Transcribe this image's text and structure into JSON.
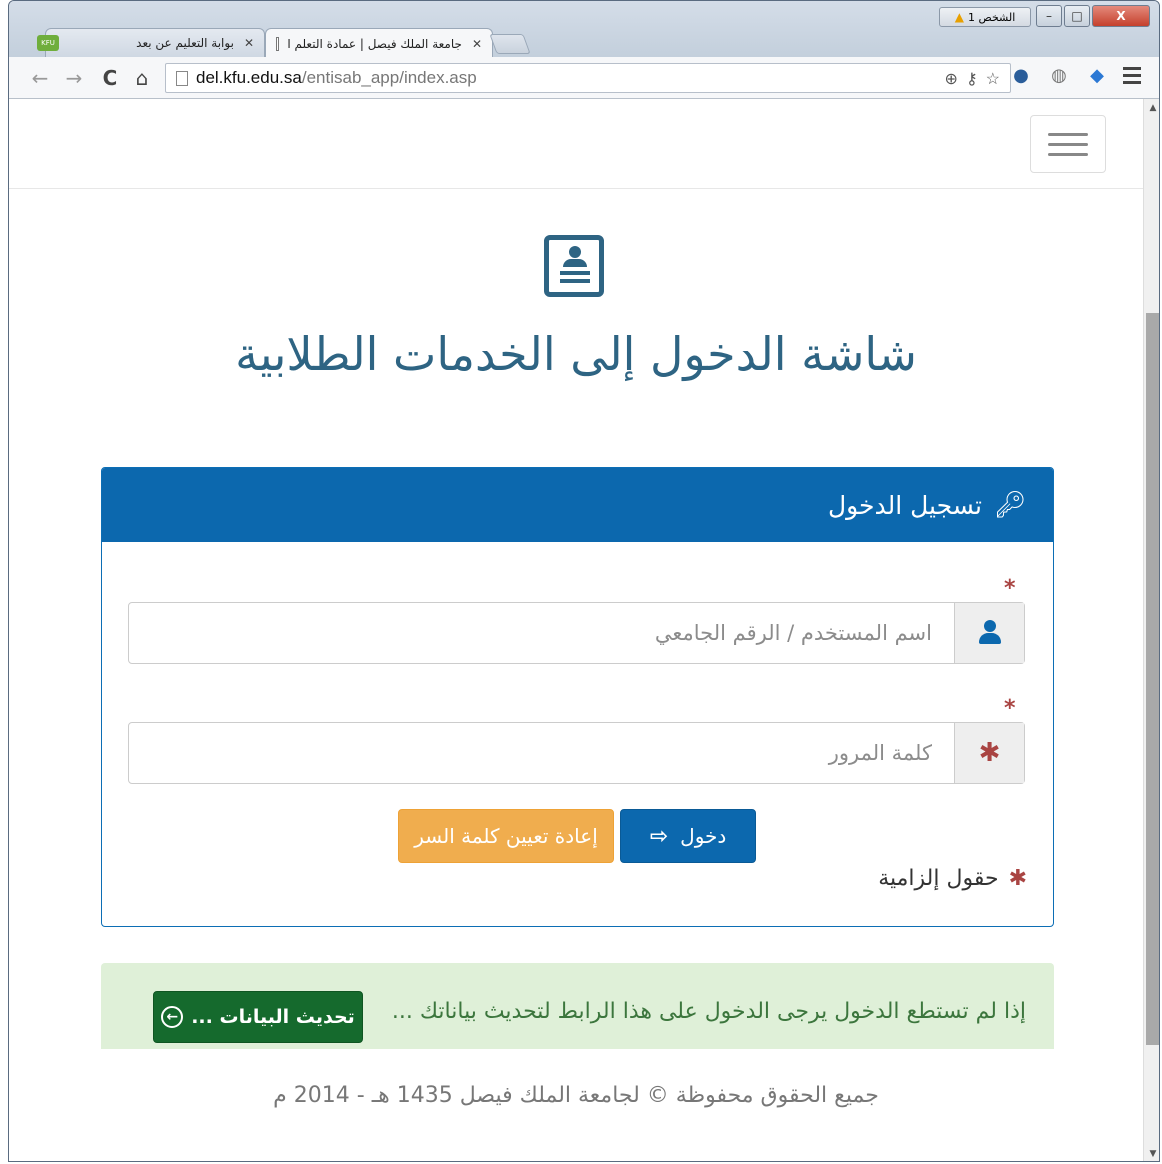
{
  "browser": {
    "tabs": [
      {
        "label": "جامعة الملك فيصل | عمادة التعلم ا",
        "active": true
      },
      {
        "label": "بوابة التعليم عن بعد",
        "active": false
      }
    ],
    "favicon_text": "KFU",
    "profile_label": "الشخص 1",
    "url_host": "del.kfu.edu.sa",
    "url_path": "/entisab_app/index.asp",
    "window_controls": {
      "minimize": "–",
      "maximize": "□",
      "close": "X"
    }
  },
  "page": {
    "title": "شاشة الدخول إلى الخدمات الطلابية",
    "login_panel": {
      "heading": "تسجيل الدخول",
      "username_placeholder": "اسم المستخدم / الرقم الجامعي",
      "username_value": "",
      "password_placeholder": "كلمة المرور",
      "password_value": "",
      "login_button": "دخول",
      "reset_button": "إعادة تعيين كلمة السر",
      "required_note": "حقول إلزامية",
      "required_mark": "*"
    },
    "alert": {
      "text": "إذا لم تستطع الدخول يرجى الدخول على هذا الرابط لتحديث بياناتك ...",
      "button": "تحديث البيانات ..."
    },
    "footer": "جميع الحقوق محفوظة © لجامعة الملك فيصل 1435 هـ - 2014 م"
  },
  "colors": {
    "primary": "#0c68ae",
    "title": "#2e6483",
    "warning": "#f0ad4e",
    "success_bg": "#dff0d8",
    "success_text": "#3c763d",
    "success_button": "#156a2d",
    "required": "#a94442"
  },
  "icons": [
    "back-icon",
    "forward-icon",
    "reload-icon",
    "home-icon",
    "page-icon",
    "zoom-icon",
    "key-icon",
    "star-icon",
    "user-icon",
    "asterisk-icon",
    "login-icon",
    "circle-arrow-left-icon",
    "menu-icon"
  ]
}
